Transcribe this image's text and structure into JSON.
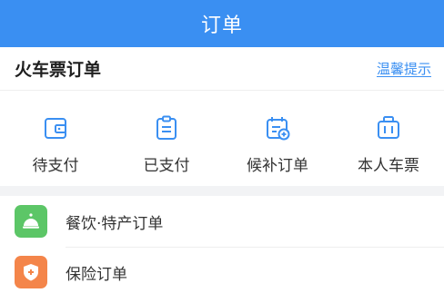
{
  "header": {
    "title": "订单"
  },
  "train_section": {
    "title": "火车票订单",
    "tips_link": "温馨提示"
  },
  "quick_actions": [
    {
      "label": "待支付",
      "icon": "wallet-icon"
    },
    {
      "label": "已支付",
      "icon": "clipboard-icon"
    },
    {
      "label": "候补订单",
      "icon": "calendar-add-icon"
    },
    {
      "label": "本人车票",
      "icon": "suitcase-icon"
    }
  ],
  "order_list": [
    {
      "label": "餐饮·特产订单",
      "icon": "food-bell-icon",
      "color": "#5cc667"
    },
    {
      "label": "保险订单",
      "icon": "shield-icon",
      "color": "#f4854a"
    }
  ],
  "colors": {
    "brand": "#3a8ff2",
    "text": "#333333"
  }
}
